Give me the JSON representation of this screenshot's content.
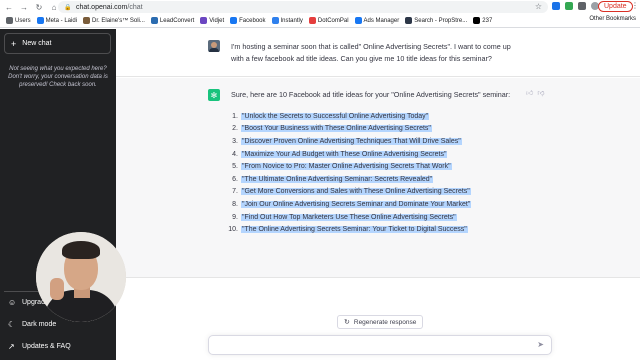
{
  "browser": {
    "url_domain": "chat.openai.com",
    "url_path": "/chat",
    "update_label": "Update"
  },
  "bookmarks": [
    {
      "label": "Users",
      "color": "#5f6368"
    },
    {
      "label": "Meta - Laidi",
      "color": "#1877f2"
    },
    {
      "label": "Dr. Elaine's™ Soli...",
      "color": "#7a5c3a"
    },
    {
      "label": "LeadConvert",
      "color": "#2b6cb0"
    },
    {
      "label": "Vidjet",
      "color": "#6b46c1"
    },
    {
      "label": "Facebook",
      "color": "#1877f2"
    },
    {
      "label": "Instantly",
      "color": "#2f80ed"
    },
    {
      "label": "DotComPal",
      "color": "#e53e3e"
    },
    {
      "label": "Ads Manager",
      "color": "#1877f2"
    },
    {
      "label": "Search - PropStre...",
      "color": "#2d3748"
    },
    {
      "label": "237",
      "color": "#000000"
    }
  ],
  "bookmarks_other": "Other Bookmarks",
  "sidebar": {
    "new_chat": "New chat",
    "note": "Not seeing what you expected here? Don't worry, your conversation data is preserved! Check back soon.",
    "upgrade": "Upgrade",
    "dark_mode": "Dark mode",
    "updates_faq": "Updates & FAQ"
  },
  "conversation": {
    "user_message": "I'm hosting a seminar soon that is called\" Online Advertising Secrets\". I want to come up with a few facebook ad title ideas. Can you give me 10 title ideas for this seminar?",
    "assistant_intro": "Sure, here are 10 Facebook ad title ideas for your \"Online Advertising Secrets\" seminar:",
    "ideas": [
      {
        "num": "1.",
        "text": "\"Unlock the Secrets to Successful Online Advertising Today\""
      },
      {
        "num": "2.",
        "text": "\"Boost Your Business with These Online Advertising Secrets\""
      },
      {
        "num": "3.",
        "text": "\"Discover Proven Online Advertising Techniques That Will Drive Sales\""
      },
      {
        "num": "4.",
        "text": "\"Maximize Your Ad Budget with These Online Advertising Secrets\""
      },
      {
        "num": "5.",
        "text": "\"From Novice to Pro: Master Online Advertising Secrets That Work\""
      },
      {
        "num": "6.",
        "text": "\"The Ultimate Online Advertising Seminar: Secrets Revealed\""
      },
      {
        "num": "7.",
        "text": "\"Get More Conversions and Sales with These Online Advertising Secrets\""
      },
      {
        "num": "8.",
        "text": "\"Join Our Online Advertising Secrets Seminar and Dominate Your Market\""
      },
      {
        "num": "9.",
        "text": "\"Find Out How Top Marketers Use These Online Advertising Secrets\""
      },
      {
        "num": "10.",
        "text": "\"The Online Advertising Secrets Seminar: Your Ticket to Digital Success\""
      }
    ]
  },
  "composer": {
    "regenerate": "Regenerate response"
  },
  "colors": {
    "sidebar_bg": "#202123",
    "accent_gpt": "#19c37d",
    "selection_highlight": "#b4d5fe"
  },
  "icons": {
    "back": "back-arrow-icon",
    "forward": "forward-arrow-icon",
    "reload": "reload-icon",
    "lock": "lock-icon",
    "star": "bookmark-star-icon",
    "plus": "plus-icon",
    "user": "user-icon",
    "moon": "moon-icon",
    "external": "external-link-icon",
    "regen": "refresh-icon",
    "send": "send-icon",
    "thumbs_up": "thumbs-up-icon",
    "thumbs_down": "thumbs-down-icon"
  }
}
